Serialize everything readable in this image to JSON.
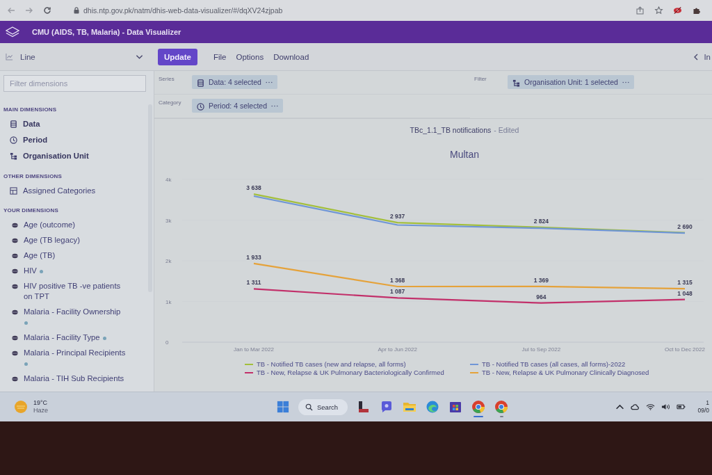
{
  "browser": {
    "url": "dhis.ntp.gov.pk/natm/dhis-web-data-visualizer/#/dqXV24zjpab"
  },
  "header": {
    "title": "CMU (AIDS, TB, Malaria) - Data Visualizer"
  },
  "toolbar": {
    "visualization_type": {
      "label": "Line"
    },
    "buttons": [
      {
        "label": "Update",
        "kind": "primary"
      },
      {
        "label": "File",
        "kind": "menu"
      },
      {
        "label": "Options",
        "kind": "menu"
      },
      {
        "label": "Download",
        "kind": "menu"
      }
    ],
    "interpretations": {
      "label": "In"
    }
  },
  "sidebar": {
    "dimension_filter": {
      "placeholder": "Filter dimensions"
    },
    "sections": [
      {
        "heading": "MAIN DIMENSIONS",
        "kind": "main",
        "items": [
          {
            "label": "Data",
            "kind": "data"
          },
          {
            "label": "Period",
            "kind": "period"
          },
          {
            "label": "Organisation Unit",
            "kind": "orgunit"
          }
        ]
      },
      {
        "heading": "OTHER DIMENSIONS",
        "kind": "other",
        "items": [
          {
            "label": "Assigned Categories",
            "kind": "category"
          }
        ]
      },
      {
        "heading": "YOUR DIMENSIONS",
        "kind": "your",
        "items": [
          {
            "label": "Age (outcome)",
            "kind": "dimension",
            "dot": false
          },
          {
            "label": "Age (TB legacy)",
            "kind": "dimension",
            "dot": false
          },
          {
            "label": "Age (TB)",
            "kind": "dimension",
            "dot": false
          },
          {
            "label": "HIV",
            "kind": "dimension",
            "dot": true
          },
          {
            "label": "HIV positive TB -ve patients on TPT",
            "kind": "dimension",
            "dot": false
          },
          {
            "label": "Malaria - Facility Ownership",
            "kind": "dimension",
            "dot": true
          },
          {
            "label": "Malaria - Facility Type",
            "kind": "dimension",
            "dot": true
          },
          {
            "label": "Malaria - Principal Recipients",
            "kind": "dimension",
            "dot": true
          },
          {
            "label": "Malaria - TIH Sub Recipients",
            "kind": "dimension",
            "dot": false
          }
        ]
      }
    ]
  },
  "layout": {
    "axes": [
      {
        "label": "Series",
        "chips": [
          {
            "label": "Data: 4 selected",
            "kind": "data"
          }
        ]
      },
      {
        "label": "Filter",
        "chips": [
          {
            "label": "Organisation Unit: 1 selected",
            "kind": "orgunit"
          }
        ]
      },
      {
        "label": "Category",
        "chips": [
          {
            "label": "Period: 4 selected",
            "kind": "period"
          }
        ]
      }
    ]
  },
  "chart": {
    "title": "TBc_1.1_TB notifications",
    "edit_status": "- Edited",
    "chart_data": {
      "type": "line",
      "title": "Multan",
      "categories": [
        "Jan to Mar 2022",
        "Apr to Jun 2022",
        "Jul to Sep 2022",
        "Oct to Dec 2022"
      ],
      "ylim": [
        0,
        4000
      ],
      "yticks": [
        {
          "value": 0,
          "label": "0"
        },
        {
          "value": 1000,
          "label": "1k"
        },
        {
          "value": 2000,
          "label": "2k"
        },
        {
          "value": 3000,
          "label": "3k"
        },
        {
          "value": 4000,
          "label": "4k"
        }
      ],
      "data_labels": true,
      "legend": "bottom",
      "series": [
        {
          "name": "TB - Notified TB cases (new and relapse, all forms)",
          "color": "#a3bf3c",
          "values": [
            3638,
            2937,
            2824,
            2690
          ],
          "value_labels": [
            "3 638",
            "2 937",
            "2 824",
            "2 690"
          ]
        },
        {
          "name": "TB - Notified TB cases (all cases, all forms)-2022",
          "color": "#6f96d6",
          "values": [
            3590,
            2880,
            2800,
            2680
          ],
          "value_labels": [
            null,
            null,
            null,
            null
          ]
        },
        {
          "name": "TB - New, Relapse & UK Pulmonary Bacteriologically Confirmed",
          "color": "#c2306a",
          "values": [
            1311,
            1087,
            964,
            1048
          ],
          "value_labels": [
            "1 311",
            "1 087",
            "964",
            "1 048"
          ]
        },
        {
          "name": "TB - New, Relapse & UK Pulmonary Clinically Diagnosed",
          "color": "#e5a23a",
          "values": [
            1933,
            1368,
            1369,
            1315
          ],
          "value_labels": [
            "1 933",
            "1 368",
            "1 369",
            "1 315"
          ]
        }
      ]
    }
  },
  "taskbar": {
    "weather": {
      "temperature": "19°C",
      "condition": "Haze"
    },
    "search": {
      "label": "Search"
    },
    "apps": [
      {
        "kind": "tile",
        "open": false,
        "focused": false
      },
      {
        "kind": "chat",
        "open": false,
        "focused": false
      },
      {
        "kind": "folder",
        "open": false,
        "focused": false
      },
      {
        "kind": "wave",
        "open": false,
        "focused": false
      },
      {
        "kind": "store",
        "open": false,
        "focused": false
      },
      {
        "kind": "browser",
        "open": true,
        "focused": true
      },
      {
        "kind": "browser",
        "open": true,
        "focused": false
      }
    ],
    "clock": {
      "time": "1",
      "date": "09/0"
    }
  }
}
